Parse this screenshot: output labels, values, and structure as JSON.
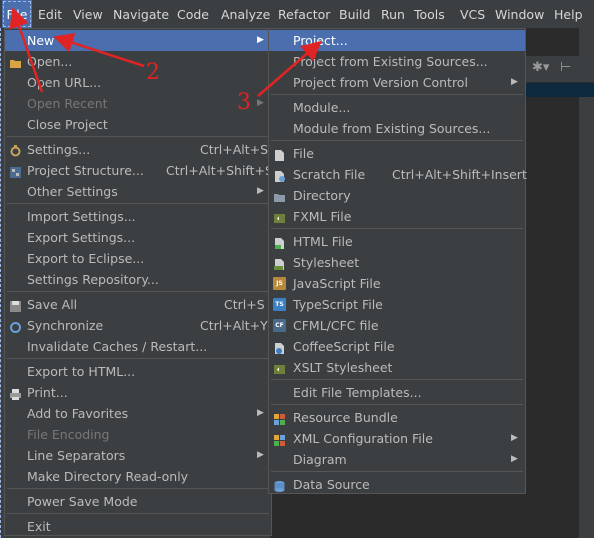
{
  "menubar": {
    "items": [
      "File",
      "Edit",
      "View",
      "Navigate",
      "Code",
      "Analyze",
      "Refactor",
      "Build",
      "Run",
      "Tools",
      "VCS",
      "Window",
      "Help"
    ]
  },
  "file_menu": {
    "new": "New",
    "open": "Open...",
    "open_url": "Open URL...",
    "open_recent": "Open Recent",
    "close_project": "Close Project",
    "settings": "Settings...",
    "settings_sc": "Ctrl+Alt+S",
    "project_structure": "Project Structure...",
    "project_structure_sc": "Ctrl+Alt+Shift+S",
    "other_settings": "Other Settings",
    "import_settings": "Import Settings...",
    "export_settings": "Export Settings...",
    "export_eclipse": "Export to Eclipse...",
    "settings_repository": "Settings Repository...",
    "save_all": "Save All",
    "save_all_sc": "Ctrl+S",
    "synchronize": "Synchronize",
    "synchronize_sc": "Ctrl+Alt+Y",
    "invalidate_caches": "Invalidate Caches / Restart...",
    "export_html": "Export to HTML...",
    "print": "Print...",
    "add_favorites": "Add to Favorites",
    "file_encoding": "File Encoding",
    "line_separators": "Line Separators",
    "make_readonly": "Make Directory Read-only",
    "power_save": "Power Save Mode",
    "exit": "Exit"
  },
  "new_menu": {
    "project": "Project...",
    "project_existing": "Project from Existing Sources...",
    "project_vcs": "Project from Version Control",
    "module": "Module...",
    "module_existing": "Module from Existing Sources...",
    "file": "File",
    "scratch_file": "Scratch File",
    "scratch_file_sc": "Ctrl+Alt+Shift+Insert",
    "directory": "Directory",
    "fxml_file": "FXML File",
    "html_file": "HTML File",
    "stylesheet": "Stylesheet",
    "javascript_file": "JavaScript File",
    "typescript_file": "TypeScript File",
    "cfml_file": "CFML/CFC file",
    "coffeescript_file": "CoffeeScript File",
    "xslt_stylesheet": "XSLT Stylesheet",
    "edit_templates": "Edit File Templates...",
    "resource_bundle": "Resource Bundle",
    "xml_config": "XML Configuration File",
    "diagram": "Diagram",
    "data_source": "Data Source"
  },
  "annotations": {
    "n2": "2",
    "n3": "3"
  },
  "file_icon_badges": {
    "js": "JS",
    "ts": "TS",
    "cf": "CF"
  },
  "colors": {
    "menu_bg": "#3c3f41",
    "selection": "#4b6eaf",
    "annotation": "#e02424",
    "editor_bg": "#2b2b2b"
  }
}
